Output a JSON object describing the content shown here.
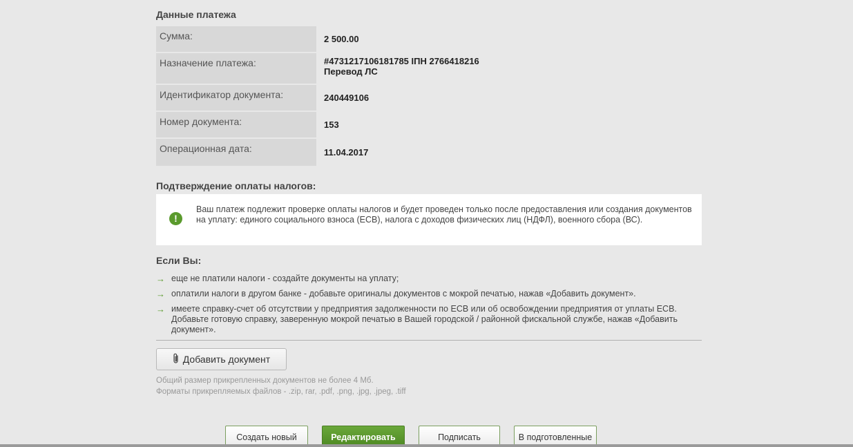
{
  "payment_section": {
    "title": "Данные платежа",
    "rows": [
      {
        "label": "Сумма:",
        "value": "2 500.00"
      },
      {
        "label": "Назначение платежа:",
        "value": "#4731217106181785 ІПН 2766418216\nПеревод ЛС"
      },
      {
        "label": "Идентификатор документа:",
        "value": "240449106"
      },
      {
        "label": "Номер документа:",
        "value": "153"
      },
      {
        "label": "Операционная дата:",
        "value": "11.04.2017"
      }
    ]
  },
  "tax_confirmation": {
    "title": "Подтверждение оплаты налогов:",
    "icon": "exclamation-icon",
    "notice": "Ваш платеж подлежит проверке оплаты налогов и будет проведен только после предоставления или создания документов на уплату: единого социального взноса (ЕСВ), налога с доходов физических лиц (НДФЛ), военного сбора (ВС)."
  },
  "if_you": {
    "title": "Если Вы:",
    "arrow_symbol": "→",
    "items": [
      "еще не платили налоги - создайте документы на уплату;",
      "оплатили налоги в другом банке - добавьте оригиналы документов с мокрой печатью, нажав «Добавить документ».",
      "имеете справку-счет об отсутствии у предприятия задолженности по ЕСВ или об освобождении предприятия от уплаты ЕСВ. Добавьте готовую справку, заверенную мокрой печатью в Вашей городской / районной фискальной службе, нажав «Добавить документ»."
    ]
  },
  "attachments": {
    "add_button_label": "Добавить документ",
    "add_button_icon": "paperclip-icon",
    "hint_size": "Общий размер прикрепленных документов не более 4 Мб.",
    "hint_formats": "Форматы прикрепляемых файлов - .zip, rar, .pdf, .png, .jpg, .jpeg, .tiff"
  },
  "actions": {
    "create_new": "Создать новый",
    "edit": "Редактировать",
    "sign": "Подписать",
    "to_drafts": "В подготовленные"
  },
  "colors": {
    "accent_green": "#5a9a2c",
    "background": "#e8e8e8",
    "label_bg": "#d8d8d8"
  }
}
